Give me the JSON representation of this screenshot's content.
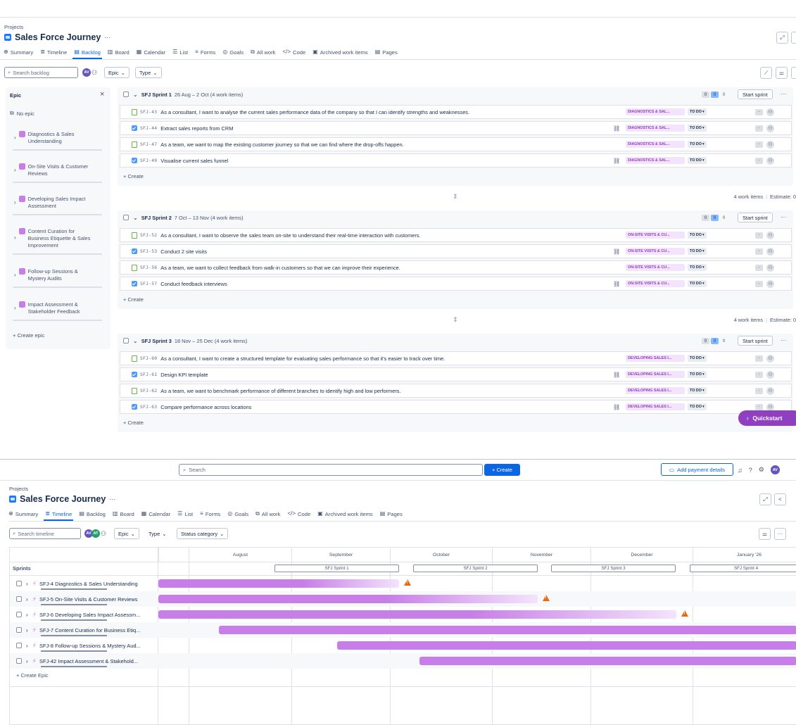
{
  "backlog_view": {
    "breadcrumb": "Projects",
    "project_title": "Sales Force Journey",
    "more_label": "···",
    "tabs": [
      {
        "label": "Summary",
        "icon": "globe-icon",
        "glyph": "⊕"
      },
      {
        "label": "Timeline",
        "icon": "timeline-icon",
        "glyph": "≣"
      },
      {
        "label": "Backlog",
        "icon": "backlog-icon",
        "glyph": "▤"
      },
      {
        "label": "Board",
        "icon": "board-icon",
        "glyph": "▥"
      },
      {
        "label": "Calendar",
        "icon": "calendar-icon",
        "glyph": "▦"
      },
      {
        "label": "List",
        "icon": "list-icon",
        "glyph": "☰"
      },
      {
        "label": "Forms",
        "icon": "forms-icon",
        "glyph": "≡"
      },
      {
        "label": "Goals",
        "icon": "goals-icon",
        "glyph": "◎"
      },
      {
        "label": "All work",
        "icon": "all-work-icon",
        "glyph": "⧉"
      },
      {
        "label": "Code",
        "icon": "code-icon",
        "glyph": "</>"
      },
      {
        "label": "Archived work items",
        "icon": "archive-icon",
        "glyph": "▣"
      },
      {
        "label": "Pages",
        "icon": "pages-icon",
        "glyph": "▤"
      }
    ],
    "active_tab": "Backlog",
    "search_placeholder": "Search backlog",
    "avatar_initials": "AV",
    "filters": [
      "Epic",
      "Type"
    ],
    "epic_panel": {
      "title": "Epic",
      "no_epic": "No epic",
      "epics": [
        [
          "Diagnostics & Sales",
          "Understanding"
        ],
        [
          "On-Site Visits & Customer",
          "Reviews"
        ],
        [
          "Developing Sales Impact",
          "Assessment"
        ],
        [
          "Content Curation for",
          "Business Etiquette & Sales",
          "Improvement"
        ],
        [
          "Follow-up Sessions &",
          "Mystery Audits"
        ],
        [
          "Impact Assessment &",
          "Stakeholder Feedback"
        ]
      ],
      "create_epic": "+ Create epic"
    },
    "sprints": [
      {
        "name": "SFJ Sprint 1",
        "dates": "26 Aug – 2 Oct (4 work items)",
        "counts": [
          "0",
          "0",
          "0"
        ],
        "start_label": "Start sprint",
        "footer_items": "4 work items",
        "footer_estimate": "Estimate: 0",
        "issues": [
          {
            "type": "story",
            "key": "SFJ-43",
            "summary": "As a consultant, I want to analyse the current sales performance data of the company so that I can identify strengths and weaknesses.",
            "epic": "DIAGNOSTICS & SAL...",
            "status": "TO DO",
            "child": false
          },
          {
            "type": "task",
            "key": "SFJ-44",
            "summary": "Extract sales reports from CRM",
            "epic": "DIAGNOSTICS & SAL...",
            "status": "TO DO",
            "child": true
          },
          {
            "type": "story",
            "key": "SFJ-47",
            "summary": "As a team, we want to map the existing customer journey so that we can find where the drop-offs happen.",
            "epic": "DIAGNOSTICS & SAL...",
            "status": "TO DO",
            "child": false
          },
          {
            "type": "task",
            "key": "SFJ-49",
            "summary": "Visualise current sales funnel",
            "epic": "DIAGNOSTICS & SAL...",
            "status": "TO DO",
            "child": true
          }
        ]
      },
      {
        "name": "SFJ Sprint 2",
        "dates": "7 Oct – 13 Nov (4 work items)",
        "counts": [
          "0",
          "0",
          "0"
        ],
        "start_label": "Start sprint",
        "footer_items": "4 work items",
        "footer_estimate": "Estimate: 0",
        "issues": [
          {
            "type": "story",
            "key": "SFJ-52",
            "summary": "As a consultant, I want to observe the sales team on-site to understand their real-time interaction with customers.",
            "epic": "ON-SITE VISITS & CU...",
            "status": "TO DO",
            "child": false
          },
          {
            "type": "task",
            "key": "SFJ-53",
            "summary": "Conduct 2 site visits",
            "epic": "ON-SITE VISITS & CU...",
            "status": "TO DO",
            "child": true
          },
          {
            "type": "story",
            "key": "SFJ-56",
            "summary": "As a team, we want to collect feedback from walk-in customers so that we can improve their experience.",
            "epic": "ON-SITE VISITS & CU...",
            "status": "TO DO",
            "child": false
          },
          {
            "type": "task",
            "key": "SFJ-57",
            "summary": "Conduct feedback interviews",
            "epic": "ON-SITE VISITS & CU...",
            "status": "TO DO",
            "child": true
          }
        ]
      },
      {
        "name": "SFJ Sprint 3",
        "dates": "18 Nov – 25 Dec (4 work items)",
        "counts": [
          "0",
          "0",
          "0"
        ],
        "start_label": "Start sprint",
        "footer_items": "",
        "footer_estimate": "",
        "issues": [
          {
            "type": "story",
            "key": "SFJ-60",
            "summary": "As a consultant, I want to create a structured template for evaluating sales performance so that it's easier to track over time.",
            "epic": "DEVELOPING SALES I...",
            "status": "TO DO",
            "child": false
          },
          {
            "type": "task",
            "key": "SFJ-61",
            "summary": "Design KPI template",
            "epic": "DEVELOPING SALES I...",
            "status": "TO DO",
            "child": true
          },
          {
            "type": "story",
            "key": "SFJ-62",
            "summary": "As a team, we want to benchmark performance of different branches to identify high and low performers.",
            "epic": "DEVELOPING SALES I...",
            "status": "TO DO",
            "child": false
          },
          {
            "type": "task",
            "key": "SFJ-63",
            "summary": "Compare performance across locations",
            "epic": "DEVELOPING SALES I...",
            "status": "TO DO",
            "child": true
          }
        ]
      }
    ],
    "create_label": "+ Create",
    "estimate_dash": "-",
    "quickstart": "Quickstart"
  },
  "timeline_view": {
    "top_search_placeholder": "Search",
    "create_button": "+ Create",
    "add_payment": "Add payment details",
    "avatar_initials": "AV",
    "breadcrumb": "Projects",
    "project_title": "Sales Force Journey",
    "more_label": "···",
    "active_tab": "Timeline",
    "search_placeholder": "Search timeline",
    "filters": [
      "Epic",
      "Type",
      "Status category"
    ],
    "months": [
      "August",
      "September",
      "October",
      "November",
      "December",
      "January '26"
    ],
    "sprints_label": "Sprints",
    "sprint_pills": [
      "SFJ Sprint 1",
      "SFJ Sprint 2",
      "SFJ Sprint 3",
      "SFJ Sprint 4"
    ],
    "epics": [
      {
        "label": "SFJ-4 Diagnostics & Sales Understanding",
        "warning": true
      },
      {
        "label": "SFJ-5 On-Site Visits & Customer Reviews",
        "warning": true
      },
      {
        "label": "SFJ-6 Developing Sales Impact Assessm...",
        "warning": true
      },
      {
        "label": "SFJ-7 Content Curation for Business Etiq...",
        "warning": false
      },
      {
        "label": "SFJ-8 Follow-up Sessions & Mystery Aud...",
        "warning": false
      },
      {
        "label": "SFJ-42 Impact Assessment & Stakehold...",
        "warning": false
      }
    ],
    "create_epic": "+ Create Epic"
  },
  "colors": {
    "accent": "#0c66e4",
    "epic": "#c77ee8",
    "warning": "#e56910",
    "quickstart": "#8f3fc0"
  }
}
